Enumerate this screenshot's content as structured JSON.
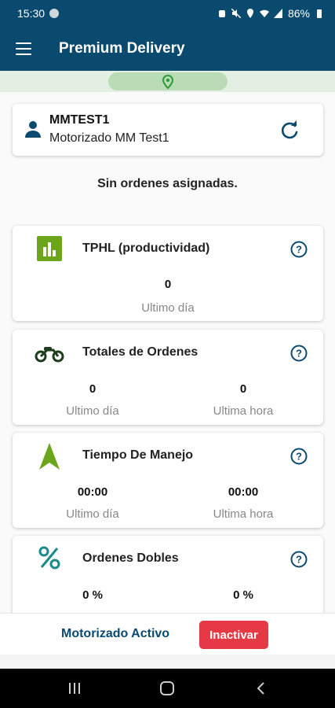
{
  "status_bar": {
    "time": "15:30",
    "battery": "86%"
  },
  "app_bar": {
    "title": "Premium Delivery",
    "menu_icon": "hamburger-menu-icon"
  },
  "map": {
    "pin_icon": "location-pin-icon"
  },
  "user": {
    "code": "MMTEST1",
    "name": "Motorizado MM Test1",
    "icon": "person-icon",
    "refresh_icon": "refresh-icon"
  },
  "orders_message": "Sin ordenes asignadas.",
  "stats": {
    "tphl": {
      "title": "TPHL (productividad)",
      "icon": "bar-chart-icon",
      "value": "0",
      "label": "Ultimo día"
    },
    "order_totals": {
      "title": "Totales de Ordenes",
      "icon": "motorcycle-icon",
      "day_value": "0",
      "day_label": "Ultimo día",
      "hour_value": "0",
      "hour_label": "Ultima hora"
    },
    "driving_time": {
      "title": "Tiempo De Manejo",
      "icon": "navigation-arrow-icon",
      "day_value": "00:00",
      "day_label": "Ultimo día",
      "hour_value": "00:00",
      "hour_label": "Ultima hora"
    },
    "double_orders": {
      "title": "Ordenes Dobles",
      "icon": "percent-icon",
      "day_value": "0 %",
      "hour_value": "0 %"
    }
  },
  "footer": {
    "status_label": "Motorizado Activo",
    "deactivate_button": "Inactivar"
  },
  "colors": {
    "primary": "#0b4a6f",
    "green": "#6aa51c",
    "danger": "#e53945",
    "teal": "#1a8a8a"
  }
}
